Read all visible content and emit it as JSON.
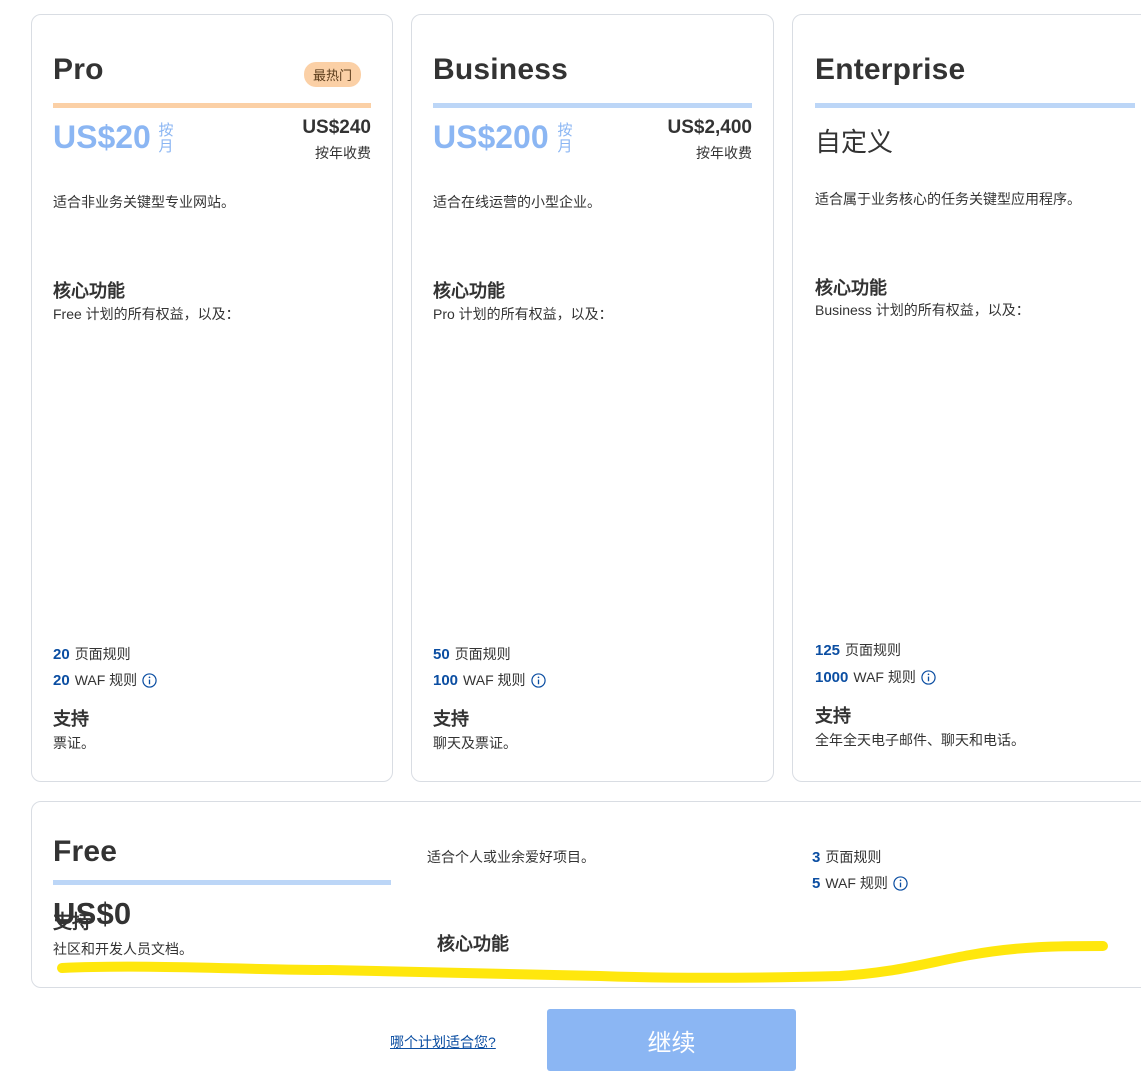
{
  "plans": {
    "pro": {
      "name": "Pro",
      "badge": "最热门",
      "price": "US$20",
      "per": "按月",
      "annual_price": "US$240",
      "annual_note": "按年收费",
      "description": "适合非业务关键型专业网站。",
      "core_heading": "核心功能",
      "core_sub": "Free 计划的所有权益，以及：",
      "page_rules_num": "20",
      "page_rules_label": "页面规则",
      "waf_rules_num": "20",
      "waf_rules_label": "WAF 规则",
      "support_heading": "支持",
      "support_text": "票证。"
    },
    "business": {
      "name": "Business",
      "price": "US$200",
      "per": "按月",
      "annual_price": "US$2,400",
      "annual_note": "按年收费",
      "description": "适合在线运营的小型企业。",
      "core_heading": "核心功能",
      "core_sub": "Pro 计划的所有权益，以及：",
      "page_rules_num": "50",
      "page_rules_label": "页面规则",
      "waf_rules_num": "100",
      "waf_rules_label": "WAF 规则",
      "support_heading": "支持",
      "support_text": "聊天及票证。"
    },
    "enterprise": {
      "name": "Enterprise",
      "price": "自定义",
      "description": "适合属于业务核心的任务关键型应用程序。",
      "core_heading": "核心功能",
      "core_sub": "Business 计划的所有权益，以及：",
      "page_rules_num": "125",
      "page_rules_label": "页面规则",
      "waf_rules_num": "1000",
      "waf_rules_label": "WAF 规则",
      "support_heading": "支持",
      "support_text": "全年全天电子邮件、聊天和电话。"
    },
    "free": {
      "name": "Free",
      "price": "US$0",
      "description": "适合个人或业余爱好项目。",
      "core_heading": "核心功能",
      "page_rules_num": "3",
      "page_rules_label": "页面规则",
      "waf_rules_num": "5",
      "waf_rules_label": "WAF 规则",
      "support_heading": "支持",
      "support_text": "社区和开发人员文档。"
    }
  },
  "footer": {
    "help_link": "哪个计划适合您?",
    "continue_label": "继续"
  },
  "colors": {
    "pro_accent": "#fbd0a6",
    "blue_accent": "#bcd6f7",
    "price_blue": "#8bb6f3",
    "rule_number": "#0b4ea2",
    "highlight_stroke": "#ffe600"
  },
  "icons": {
    "info": "info-circle-icon"
  }
}
